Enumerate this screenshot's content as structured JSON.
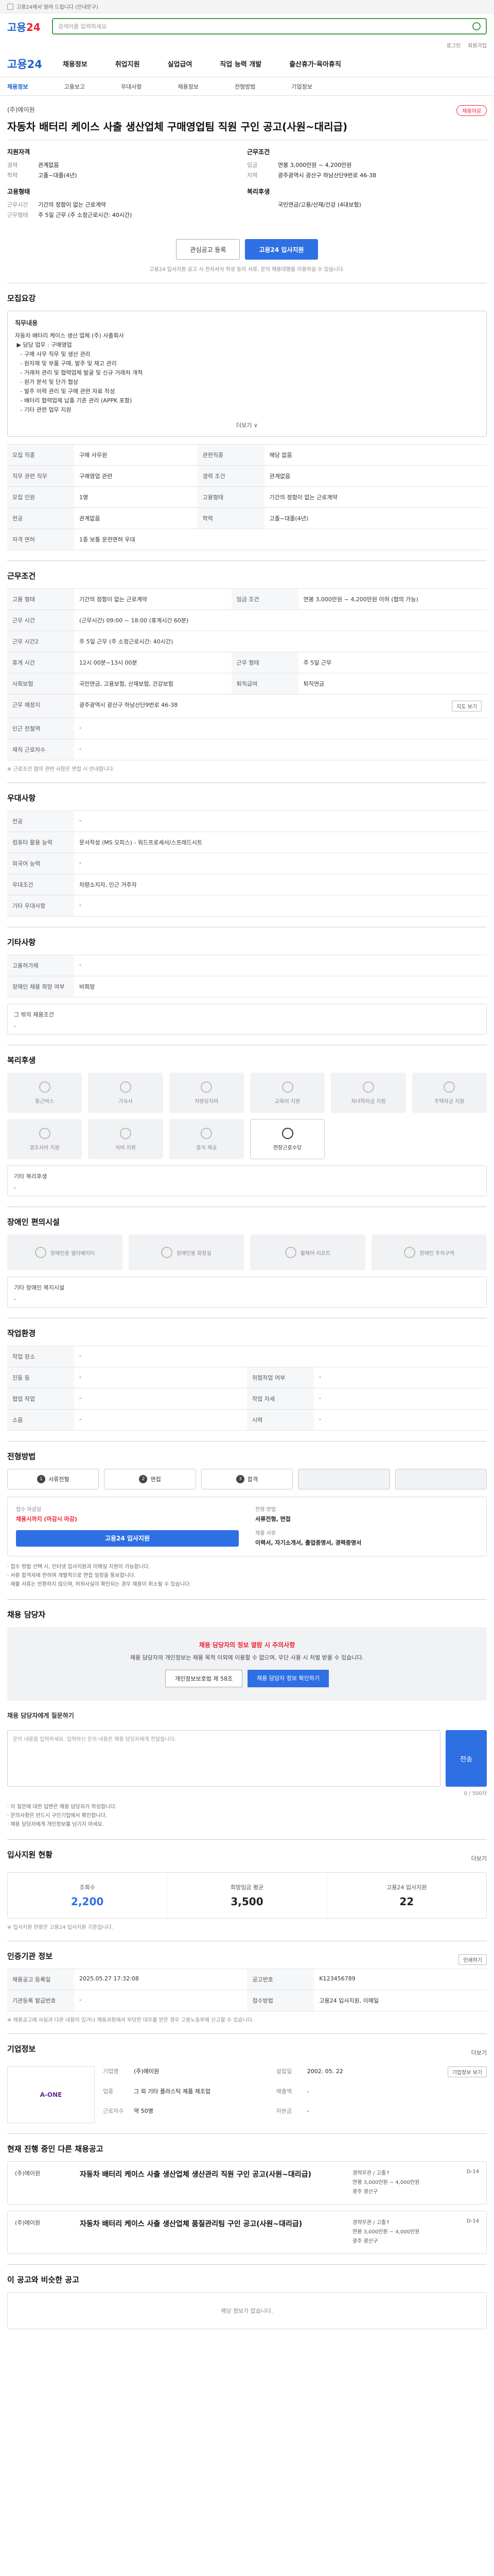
{
  "topbar": {
    "text": "고용24에서 알려 드립니다 (안내문구)"
  },
  "search": {
    "placeholder": "검색어를 입력하세요"
  },
  "util": [
    "로그인",
    "회원가입"
  ],
  "gnb": {
    "logo": "고용24",
    "items": [
      "채용정보",
      "취업지원",
      "실업급여",
      "직업 능력 개발",
      "출산휴가·육아휴직"
    ]
  },
  "lnb": [
    "채용정보",
    "고용보고",
    "우대사항",
    "채용정보",
    "전형방법",
    "기업정보"
  ],
  "job": {
    "company": "(주)에이원",
    "badge": "채용마감",
    "title": "자동차 배터리 케이스 사출 생산업체 구매영업팀 직원 구인 공고(사원~대리급)",
    "left_heading": "지원자격",
    "right_heading": "근무조건",
    "left": [
      {
        "k": "경력",
        "v": "관계없음"
      },
      {
        "k": "학력",
        "v": "고졸~대졸(4년)"
      }
    ],
    "right": [
      {
        "k": "임금",
        "v": "연봉 3,000만원 ~ 4,200만원"
      },
      {
        "k": "지역",
        "v": "광주광역시 광산구 하남산단9번로 46-38"
      }
    ],
    "left2_heading": "고용형태",
    "left2": [
      {
        "k": "근무시간",
        "v": "기간의 정함이 없는 근로계약"
      },
      {
        "k": "근무형태",
        "v": "주 5일 근무 (주 소정근로시간: 40시간)"
      }
    ],
    "right2_heading": "복리후생",
    "right2": [
      {
        "k": "",
        "v": "국민연금/고용/산재/건강 (4대보험)"
      }
    ]
  },
  "buttons": {
    "bookmark": "관심공고 등록",
    "apply": "고용24 입사지원"
  },
  "note": "고용24 입사지원 공고 시 전자서식 작성 등의 서류, 문의 채용대행을 이용하실 수 있습니다.",
  "recruit": {
    "heading": "모집요강",
    "sub": "직무내용",
    "content": "자동차 배터리 케이스 생산 업체 (주) 사출회사\n ▶ 담당 업무 : 구매영업\n   - 구매 사무 직무 및 생산 관리\n   - 원자재 및 부품 구매, 발주 및 재고 관리\n   - 거래처 관리 및 협력업체 발굴 및 신규 거래처 개척\n   - 원가 분석 및 단가 협상\n   - 발주 이력 관리 및 구매 관련 자료 작성\n   - 배터리 협력업체 납품 기준 관리 (APPK 포함)\n   - 기타 관련 업무 지원",
    "more": "더보기 ∨",
    "rows": [
      [
        "모집 직종",
        "구매 사무원",
        "관련직종",
        "해당 없음"
      ],
      [
        "직무 관련 직무",
        "구매영업 관련",
        "경력 조건",
        "관계없음"
      ],
      [
        "모집 인원",
        "1명",
        "고용형태",
        "기간의 정함이 없는 근로계약"
      ],
      [
        "전공",
        "관계없음",
        "학력",
        "고졸~대졸(4년)"
      ],
      [
        "자격 면허",
        "1종 보통 운전면허 우대",
        "",
        ""
      ]
    ]
  },
  "work": {
    "heading": "근무조건",
    "rows": [
      [
        "고용 형태",
        "기간의 정함이 없는 근로계약",
        "임금 조건",
        "연봉 3,000만원 ~ 4,200만원 이하 (협의 가능)"
      ],
      [
        "근무 시간",
        "(근무시간) 09:00 ~ 18:00 (휴게시간 60분)",
        "",
        ""
      ],
      [
        "근무 시간2",
        "주 5일 근무 (주 소정근로시간: 40시간)",
        "",
        ""
      ],
      [
        "휴게 시간",
        "12시 00분~13시 00분",
        "근무 형태",
        "주 5일 근무"
      ],
      [
        "사회보험",
        "국민연금, 고용보험, 산재보험, 건강보험",
        "퇴직급여",
        "퇴직연금"
      ],
      [
        "근무 예정지",
        "광주광역시 광산구 하남산단9번로 46-38",
        "",
        ""
      ],
      [
        "인근 전철역",
        "-",
        "",
        ""
      ],
      [
        "재직 근로자수",
        "-",
        "",
        ""
      ]
    ],
    "chip": "지도 보기",
    "foot": "※ 근로조건 협의 관련 사항은 면접 시 안내합니다."
  },
  "pref": {
    "heading": "우대사항",
    "rows": [
      [
        "전공",
        "-"
      ],
      [
        "컴퓨터 활용 능력",
        "문서작성 (MS 오피스) - 워드프로세서/스프레드시트"
      ],
      [
        "외국어 능력",
        "-"
      ],
      [
        "우대조건",
        "차량소지자, 인근 거주자"
      ],
      [
        "기타 우대사항",
        "-"
      ]
    ]
  },
  "etc": {
    "heading": "기타사항",
    "rows": [
      [
        "고용허가제",
        "-"
      ],
      [
        "장애인 채용 희망 여부",
        "비희망"
      ]
    ],
    "box_label": "그 밖의 채용조건",
    "box_value": "-"
  },
  "welfare": {
    "heading": "복리후생",
    "items": [
      "통근버스",
      "기숙사",
      "차량유지비",
      "교육비 지원",
      "자녀학자금 지원",
      "주택자금 지원",
      "경조사비 지원",
      "식비 지원",
      "중식 제공",
      "연장근로수당"
    ],
    "etc_label": "기타 복리후생",
    "etc_value": "-"
  },
  "access": {
    "heading": "장애인 편의시설",
    "items": [
      "장애인용 엘리베이터",
      "장애인용 화장실",
      "휠체어 리프트",
      "장애인 주차구역"
    ],
    "etc_label": "기타 장애인 복지시설",
    "etc_value": "-"
  },
  "workenv": {
    "heading": "작업환경",
    "rows": [
      [
        "작업 장소",
        "-",
        "",
        ""
      ],
      [
        "진동 등",
        "-",
        "위험작업 여부",
        "-"
      ],
      [
        "협업 작업",
        "-",
        "작업 자세",
        "-"
      ],
      [
        "소음",
        "-",
        "시력",
        "-"
      ]
    ]
  },
  "selection": {
    "heading": "전형방법",
    "steps": [
      "서류전형",
      "면접",
      "합격",
      "",
      ""
    ],
    "m1_label": "접수 마감일",
    "m1_value": "채용시까지",
    "m1_red": "채용시까지 (마감시 마감)",
    "m2_label": "전형 방법",
    "m2_value": "서류전형, 면접",
    "m3_label": "제출 서류",
    "m3_value": "이력서, 자기소개서, 졸업증명서, 경력증명서",
    "apply_btn": "고용24 입사지원",
    "bullets": [
      "접수 방법 선택 시, 인터넷 입사지원과 이메일 지원이 가능합니다.",
      "서류 합격자에 한하여 개별적으로 면접 일정을 통보합니다.",
      "제출 서류는 반환하지 않으며, 허위사실이 확인되는 경우 채용이 취소될 수 있습니다."
    ]
  },
  "manager": {
    "heading": "채용 담당자",
    "warn_title": "채용 담당자의 정보 열람 시 주의사항",
    "warn_desc": "채용 담당자의 개인정보는 채용 목적 이외에 이용할 수 없으며, 무단 사용 시 처벌 받을 수 있습니다.",
    "b1": "개인정보보호법 제 58조",
    "b2": "채용 담당자 정보 확인하기",
    "inq_label": "채용 담당자에게 질문하기",
    "inq_placeholder": "문의 내용을 입력하세요. 입력하신 문의 내용은 채용 담당자에게 전달됩니다.",
    "inq_count": "0 / 500자",
    "send": "전송",
    "notes": [
      "이 질문에 대한 답변은 채용 담당자가 작성합니다.",
      "문의사항은 반드시 구인기업에서 확인합니다.",
      "채용 담당자에게 개인정보를 남기지 마세요."
    ]
  },
  "stats": {
    "heading": "입사지원 현황",
    "more": "더보기",
    "items": [
      {
        "l": "조회수",
        "n": "2,200"
      },
      {
        "l": "희망임금 평균",
        "n": "3,500"
      },
      {
        "l": "고용24 입사지원",
        "n": "22"
      }
    ],
    "foot": "※ 입사지원 현황은 고용24 입사지원 기준입니다."
  },
  "info": {
    "heading": "인증기관 정보",
    "chip": "인쇄하기",
    "rows": [
      [
        "채용공고 등록일",
        "2025.05.27 17:32:08",
        "공고번호",
        "K123456789"
      ],
      [
        "기관등록 발급번호",
        "-",
        "접수방법",
        "고용24 입사지원, 이메일"
      ]
    ],
    "foot": "※ 채용공고에 사실과 다른 내용이 있거나 채용과정에서 부당한 대우를 받은 경우 고용노동부에 신고할 수 있습니다."
  },
  "company": {
    "heading": "기업정보",
    "more": "더보기",
    "logo": "A-ONE",
    "rows": [
      [
        "기업명",
        "(주)에이원"
      ],
      [
        "설립일",
        "2002. 05. 22"
      ],
      [
        "업종",
        "그 외 기타 플라스틱 제품 제조업"
      ],
      [
        "매출액",
        "-"
      ],
      [
        "근로자수",
        "약 50명"
      ],
      [
        "자본금",
        "-"
      ]
    ],
    "chip": "기업정보 보기"
  },
  "rec": {
    "heading": "현재 진행 중인 다른 채용공고",
    "items": [
      {
        "c": "(주)에이원",
        "t": "자동차 배터리 케이스 사출 생산업체 생산관리 직원 구인 공고(사원~대리급)",
        "r": "경력무관 / 고졸↑\n연봉 3,000만원 ~ 4,000만원\n광주 광산구",
        "s": "D-14"
      },
      {
        "c": "(주)에이원",
        "t": "자동차 배터리 케이스 사출 생산업체 품질관리팀 구인 공고(사원~대리급)",
        "r": "경력무관 / 고졸↑\n연봉 3,000만원 ~ 4,000만원\n광주 광산구",
        "s": "D-14"
      }
    ]
  },
  "other": {
    "heading": "이 공고와 비슷한 공고",
    "empty": "해당 정보가 없습니다."
  }
}
